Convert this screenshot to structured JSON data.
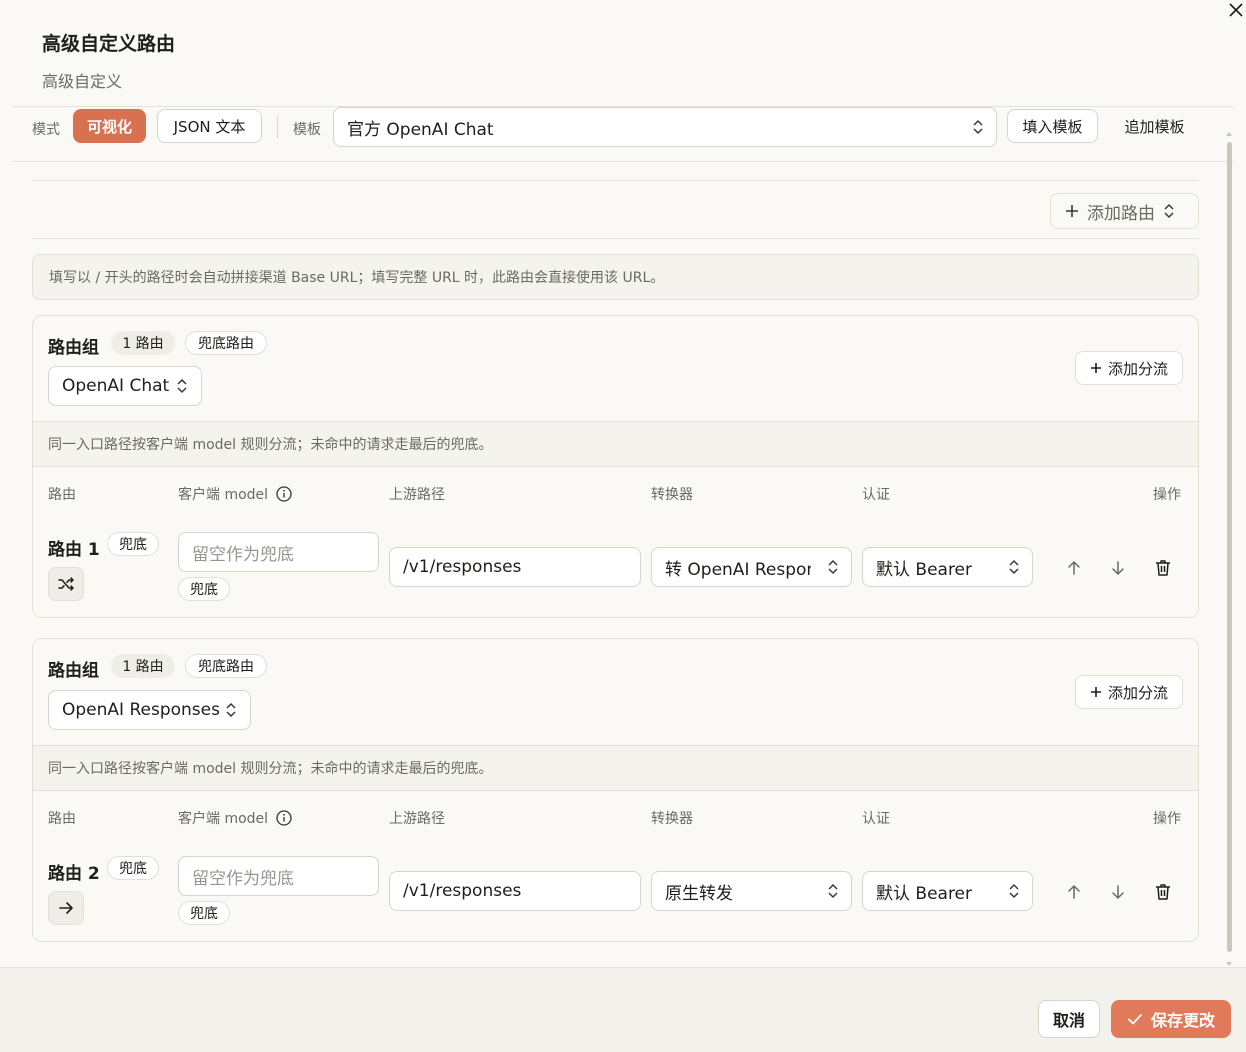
{
  "dialog": {
    "title": "高级自定义路由",
    "subtitle": "高级自定义"
  },
  "toolbar": {
    "mode_label": "模式",
    "mode_visual": "可视化",
    "mode_json": "JSON 文本",
    "template_label": "模板",
    "template_value": "官方 OpenAI Chat",
    "fill_template": "填入模板",
    "append_template": "追加模板"
  },
  "routes_panel": {
    "add_route": "添加路由",
    "hint": "填写以 / 开头的路径时会自动拼接渠道 Base URL；填写完整 URL 时，此路由会直接使用该 URL。"
  },
  "columns": {
    "route": "路由",
    "client_model": "客户端 model",
    "upstream_path": "上游路径",
    "converter": "转换器",
    "auth": "认证",
    "actions": "操作"
  },
  "groups": [
    {
      "title": "路由组",
      "count_badge": "1 路由",
      "fallback_badge": "兜底路由",
      "entry": "OpenAI Chat",
      "add_split": "添加分流",
      "description": "同一入口路径按客户端 model 规则分流；未命中的请求走最后的兜底。",
      "route": {
        "name": "路由 1",
        "badge": "兜底",
        "icon": "shuffle-icon",
        "model_placeholder": "留空作为兜底",
        "model_badge": "兜底",
        "upstream_path": "/v1/responses",
        "converter": "转 OpenAI Responses",
        "auth": "默认 Bearer"
      }
    },
    {
      "title": "路由组",
      "count_badge": "1 路由",
      "fallback_badge": "兜底路由",
      "entry": "OpenAI Responses",
      "add_split": "添加分流",
      "description": "同一入口路径按客户端 model 规则分流；未命中的请求走最后的兜底。",
      "route": {
        "name": "路由 2",
        "badge": "兜底",
        "icon": "arrow-right-icon",
        "model_placeholder": "留空作为兜底",
        "model_badge": "兜底",
        "upstream_path": "/v1/responses",
        "converter": "原生转发",
        "auth": "默认 Bearer"
      }
    }
  ],
  "footer": {
    "cancel": "取消",
    "save": "保存更改"
  },
  "colors": {
    "accent": "#d9704f",
    "save": "#e07a5a",
    "background": "#faf9f5"
  }
}
